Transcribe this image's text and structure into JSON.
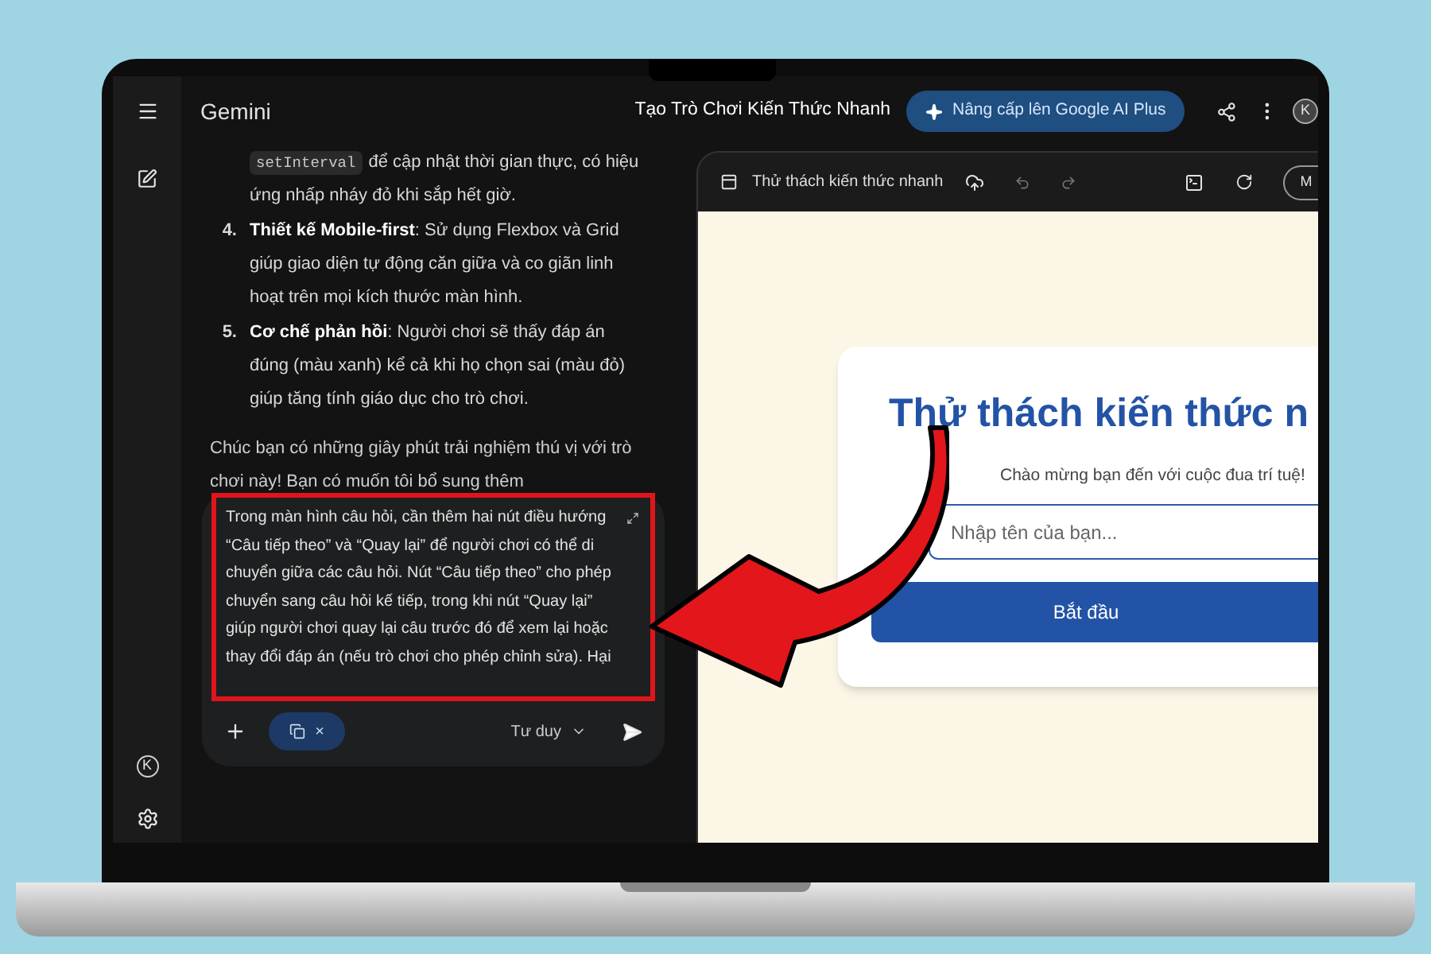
{
  "app": {
    "name": "Gemini",
    "chat_title": "Tạo Trò Chơi Kiến Thức Nhanh",
    "upgrade_button": "Nâng cấp lên Google AI Plus",
    "avatar": "K"
  },
  "sidebar": {
    "account_badge": "K"
  },
  "chat": {
    "code": "setInterval",
    "continuation": "để cập nhật thời gian thực, có hiệu ứng nhấp nháy đỏ khi sắp hết giờ.",
    "list": [
      {
        "number": "4.",
        "text": "**Thiết kế Mobile-first**: Sử dụng Flexbox và Grid giúp giao diện tự động căn giữa và co giãn linh hoạt trên mọi kích thước màn hình."
      },
      {
        "number": "5.",
        "text": "**Cơ chế phản hồi**: Người chơi sẽ thấy đáp án đúng (màu xanh) kể cả khi họ chọn sai (màu đỏ) giúp tăng tính giáo dục cho trò chơi."
      }
    ],
    "closing": "Chúc bạn có những giây phút trải nghiệm thú vị với trò chơi này! Bạn có muốn tôi bổ sung thêm"
  },
  "prompt": {
    "text": "Trong màn hình câu hỏi, cần thêm hai nút điều hướng “Câu tiếp theo” và “Quay lại” để người chơi có thể di chuyển giữa các câu hỏi. Nút “Câu tiếp theo” cho phép chuyển sang câu hỏi kế tiếp, trong khi nút “Quay lại” giúp người chơi quay lại câu trước đó để xem lại hoặc thay đổi đáp án (nếu trò chơi cho phép chỉnh sửa). Hại",
    "highlighted": true,
    "chip_close": "×",
    "mode": "Tư duy"
  },
  "canvas": {
    "title": "Thử thách kiến thức nhanh",
    "account": "M",
    "heading": "Thử thách kiến thức n",
    "subtitle": "Chào mừng bạn đến với cuộc đua trí tuệ!",
    "name_placeholder": "Nhập tên của bạn...",
    "start_button": "Bắt đầu"
  }
}
